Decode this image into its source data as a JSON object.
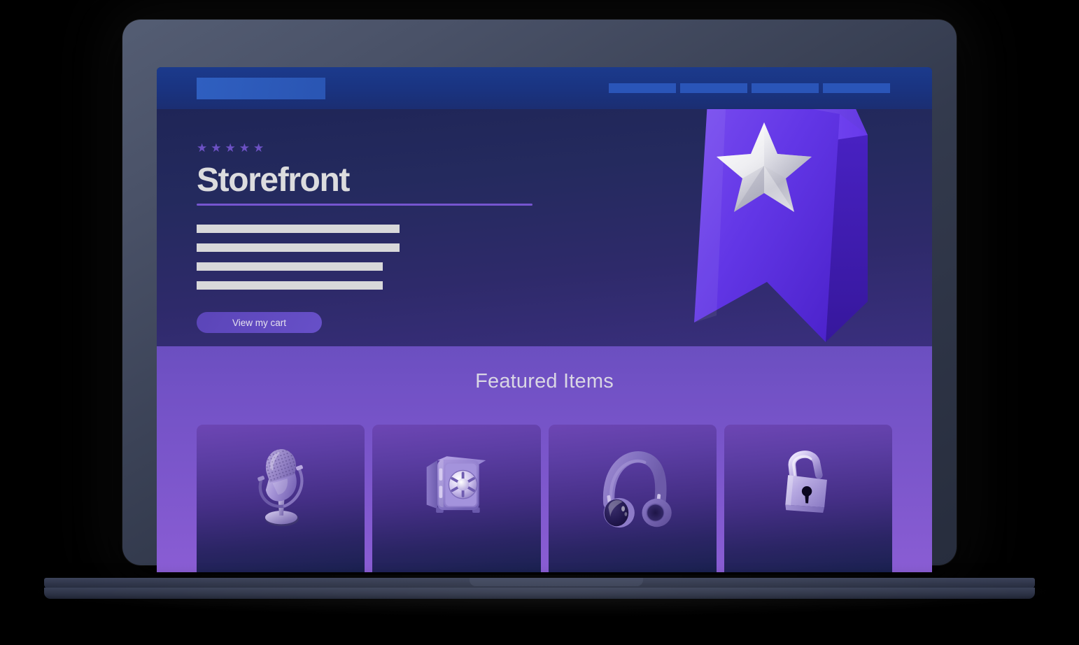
{
  "device": {
    "type": "laptop-mockup",
    "frame_color": "#3b4257",
    "base_color": "#2e3448"
  },
  "site": {
    "navbar": {
      "logo_placeholder_label": "",
      "logo_color": "#2f5fc0",
      "background_color": "#1a3380",
      "links": [
        {
          "label": "",
          "name": "nav-link-1"
        },
        {
          "label": "",
          "name": "nav-link-2"
        },
        {
          "label": "",
          "name": "nav-link-3"
        },
        {
          "label": "",
          "name": "nav-link-4"
        }
      ]
    },
    "hero": {
      "rating": {
        "stars_filled": 5,
        "star_glyph": "★",
        "star_color": "#6c51c4"
      },
      "title": "Storefront",
      "title_color": "#dcdcde",
      "rule_color": "#7655d0",
      "body_placeholder_lines": [
        "",
        "",
        "",
        ""
      ],
      "cta_label": "View my cart",
      "cta_color": "#6750c8",
      "graphic": {
        "name": "bookmark-star-3d",
        "bookmark_color": "#5b33e0",
        "star_color": "#e8e8ee"
      },
      "background_gradient": [
        "#1f2557",
        "#3a2f7e"
      ]
    },
    "featured": {
      "heading": "Featured Items",
      "heading_color": "#d9d6e4",
      "background_gradient": [
        "#6b4fc0",
        "#8a5dd4"
      ],
      "cards": [
        {
          "icon": "microphone-3d-icon",
          "label": "",
          "name": "featured-card-microphone"
        },
        {
          "icon": "safe-vault-3d-icon",
          "label": "",
          "name": "featured-card-safe"
        },
        {
          "icon": "headphones-3d-icon",
          "label": "",
          "name": "featured-card-headphones"
        },
        {
          "icon": "padlock-3d-icon",
          "label": "",
          "name": "featured-card-padlock"
        }
      ],
      "card_gradient": [
        "#6d46b4",
        "#1a2150"
      ]
    }
  }
}
